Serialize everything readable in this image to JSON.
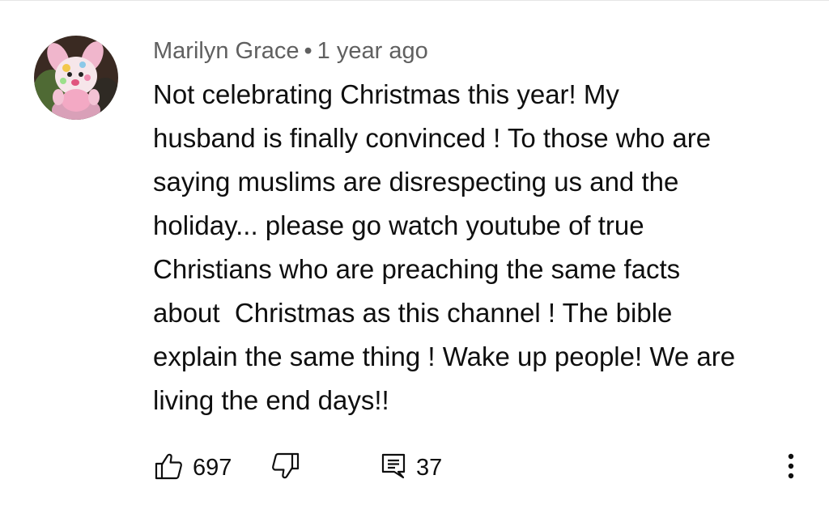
{
  "comment": {
    "author": "Marilyn Grace",
    "separator": "•",
    "timestamp": "1 year ago",
    "text": "Not celebrating Christmas this year! My\nhusband is finally convinced ! To those who are\nsaying muslims are disrespecting us and the\nholiday... please go watch youtube of true\nChristians who are preaching the same facts\nabout  Christmas as this channel ! The bible\nexplain the same thing ! Wake up people! We are\nliving the end days!!",
    "avatar_icon": "teddy-bear-avatar"
  },
  "actions": {
    "like_icon": "thumbs-up-icon",
    "like_count": "697",
    "dislike_icon": "thumbs-down-icon",
    "reply_icon": "reply-comment-icon",
    "reply_count": "37",
    "more_icon": "more-vertical-icon"
  }
}
